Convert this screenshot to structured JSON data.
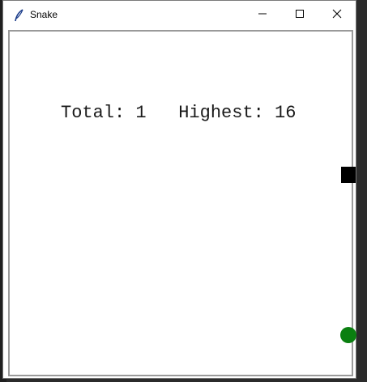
{
  "window": {
    "title": "Snake",
    "controls": {
      "minimize_icon": "minimize-icon",
      "maximize_icon": "maximize-icon",
      "close_icon": "close-icon"
    }
  },
  "game": {
    "total_label": "Total: 1   Highest: 16",
    "snake_color": "#000000",
    "food_color": "#0a7f10",
    "background_color": "#ffffff"
  }
}
